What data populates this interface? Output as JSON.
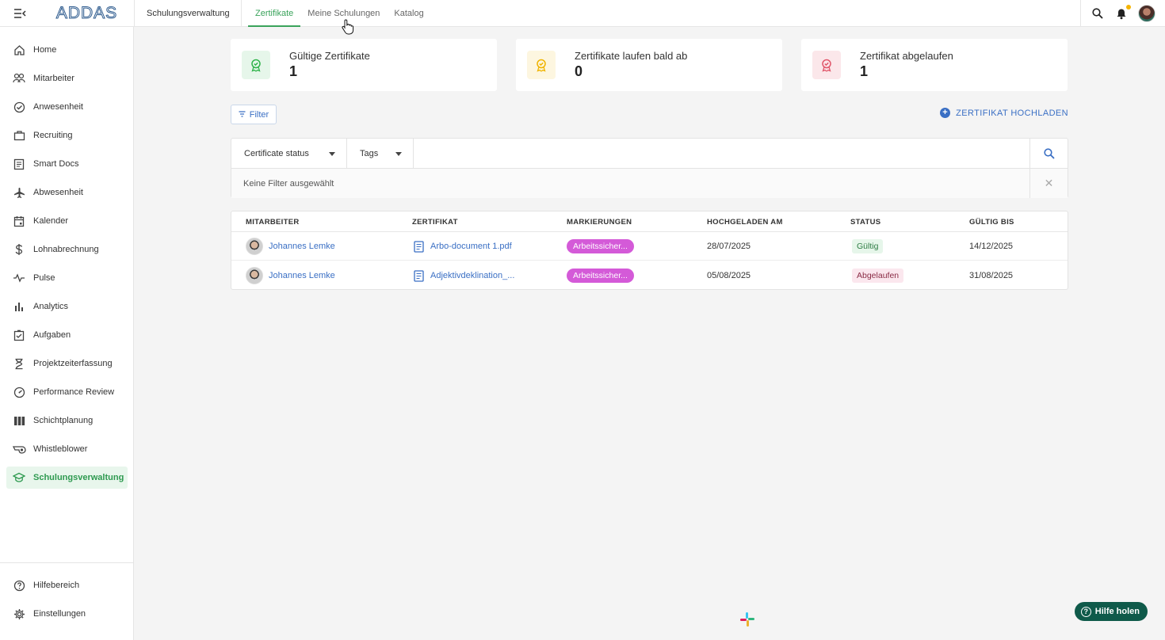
{
  "app": {
    "logo_text": "ADDAS",
    "module_title": "Schulungsverwaltung",
    "tabs": [
      {
        "label": "Zertifikate",
        "active": true
      },
      {
        "label": "Meine Schulungen",
        "active": false
      },
      {
        "label": "Katalog",
        "active": false
      }
    ],
    "accent_color": "#3aa35b",
    "link_color": "#3a6fc4"
  },
  "sidebar": {
    "items": [
      {
        "label": "Home",
        "icon": "home-icon"
      },
      {
        "label": "Mitarbeiter",
        "icon": "people-icon"
      },
      {
        "label": "Anwesenheit",
        "icon": "check-badge-icon"
      },
      {
        "label": "Recruiting",
        "icon": "briefcase-icon"
      },
      {
        "label": "Smart Docs",
        "icon": "document-icon"
      },
      {
        "label": "Abwesenheit",
        "icon": "airplane-icon"
      },
      {
        "label": "Kalender",
        "icon": "calendar-icon"
      },
      {
        "label": "Lohnabrechnung",
        "icon": "dollar-icon"
      },
      {
        "label": "Pulse",
        "icon": "pulse-icon"
      },
      {
        "label": "Analytics",
        "icon": "bar-chart-icon"
      },
      {
        "label": "Aufgaben",
        "icon": "task-icon"
      },
      {
        "label": "Projektzeiterfassung",
        "icon": "hourglass-icon"
      },
      {
        "label": "Performance Review",
        "icon": "gauge-icon"
      },
      {
        "label": "Schichtplanung",
        "icon": "columns-icon"
      },
      {
        "label": "Whistleblower",
        "icon": "whistle-icon"
      },
      {
        "label": "Schulungsverwaltung",
        "icon": "graduation-cap-icon",
        "active": true
      }
    ],
    "bottom_items": [
      {
        "label": "Hilfebereich",
        "icon": "help-circle-icon"
      },
      {
        "label": "Einstellungen",
        "icon": "settings-gear-icon"
      }
    ]
  },
  "stats": [
    {
      "label": "Gültige Zertifikate",
      "value": "1",
      "color": "#2fb34a",
      "bg": "#e6f6ea"
    },
    {
      "label": "Zertifikate laufen bald ab",
      "value": "0",
      "color": "#f0b400",
      "bg": "#fdf6e0"
    },
    {
      "label": "Zertifikat abgelaufen",
      "value": "1",
      "color": "#e0566a",
      "bg": "#fbe7ea"
    }
  ],
  "toolbar": {
    "filter_label": "Filter",
    "upload_label": "ZERTIFIKAT HOCHLADEN"
  },
  "filters": {
    "status_label": "Certificate status",
    "tags_label": "Tags",
    "search_placeholder": "",
    "no_filter_text": "Keine Filter ausgewählt"
  },
  "table": {
    "headers": [
      "MITARBEITER",
      "ZERTIFIKAT",
      "MARKIERUNGEN",
      "HOCHGELADEN AM",
      "STATUS",
      "GÜLTIG BIS"
    ],
    "rows": [
      {
        "employee": "Johannes Lemke",
        "certificate": "Arbo-document 1.pdf",
        "tag": "Arbeitssicher...",
        "uploaded": "28/07/2025",
        "status": "Gültig",
        "status_type": "ok",
        "valid_until": "14/12/2025"
      },
      {
        "employee": "Johannes Lemke",
        "certificate": "Adjektivdeklination_...",
        "tag": "Arbeitssicher...",
        "uploaded": "05/08/2025",
        "status": "Abgelaufen",
        "status_type": "bad",
        "valid_until": "31/08/2025"
      }
    ]
  },
  "help": {
    "label": "Hilfe holen"
  }
}
